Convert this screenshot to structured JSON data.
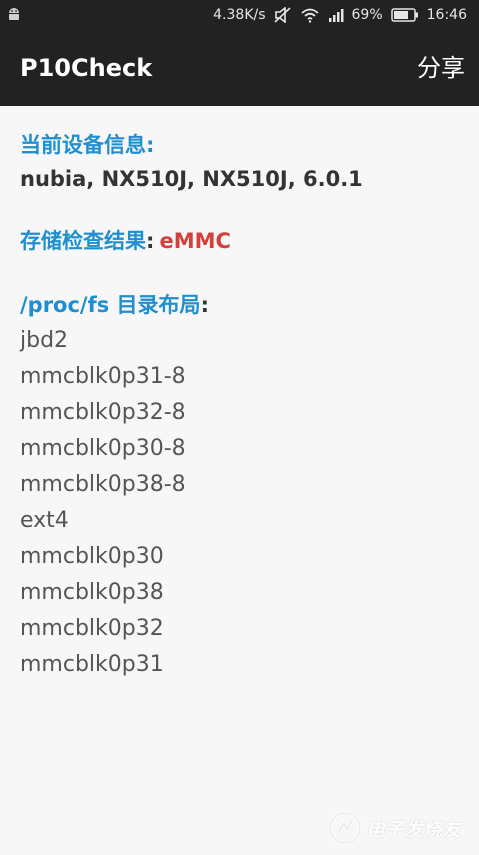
{
  "status_bar": {
    "speed": "4.38K/s",
    "battery": "69%",
    "time": "16:46"
  },
  "app_bar": {
    "title": "P10Check",
    "share_label": "分享"
  },
  "device_info": {
    "label": "当前设备信息:",
    "value": "nubia, NX510J, NX510J, 6.0.1"
  },
  "storage_check": {
    "label": "存储检查结果",
    "separator": ":",
    "value": "eMMC"
  },
  "proc_fs": {
    "label": "/proc/fs 目录布局",
    "separator": ":",
    "items": [
      "jbd2",
      "mmcblk0p31-8",
      "mmcblk0p32-8",
      "mmcblk0p30-8",
      "mmcblk0p38-8",
      "ext4",
      "mmcblk0p30",
      "mmcblk0p38",
      "mmcblk0p32",
      "mmcblk0p31"
    ]
  },
  "watermark": {
    "text": "电子发烧友"
  },
  "colors": {
    "bar_bg": "#222222",
    "label_blue": "#1f8fd0",
    "emmc_red": "#d4403c",
    "text_gray": "#555555"
  }
}
